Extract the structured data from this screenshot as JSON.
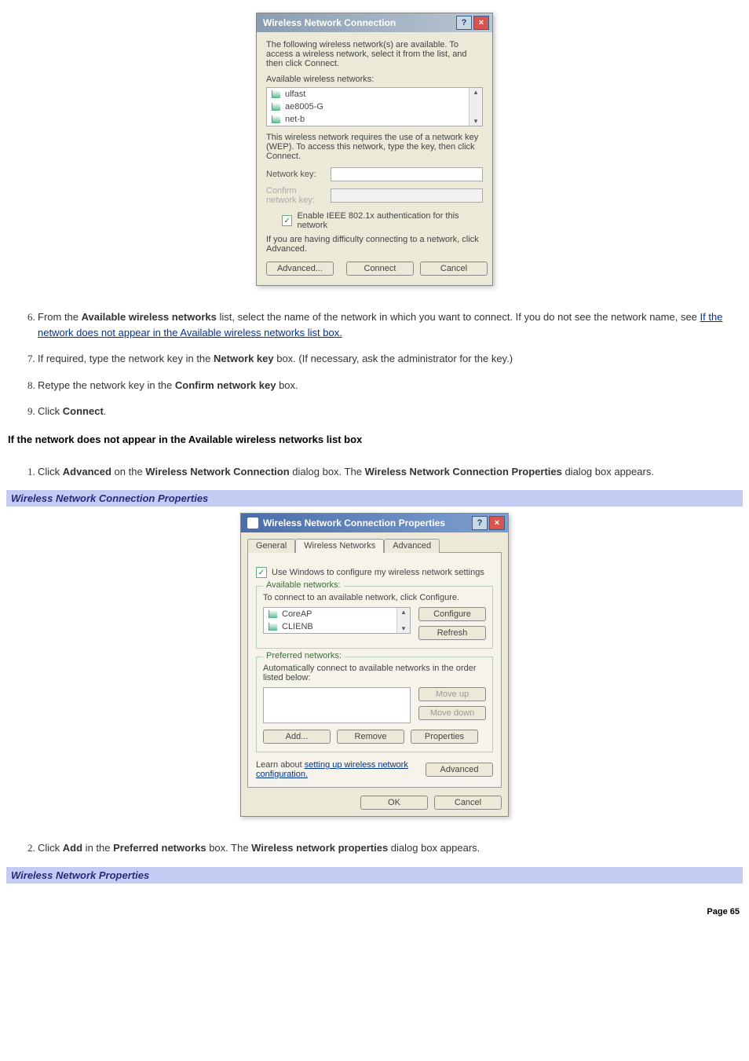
{
  "dialog1": {
    "title": "Wireless Network Connection",
    "intro": "The following wireless network(s) are available. To access a wireless network, select it from the list, and then click Connect.",
    "avail_label": "Available wireless networks:",
    "networks": [
      "ulfast",
      "ae8005-G",
      "net-b"
    ],
    "wep_text": "This wireless network requires the use of a network key (WEP). To access this network, type the key, then click Connect.",
    "netkey_label": "Network key:",
    "confirm_label": "Confirm network key:",
    "ieee_check": "Enable IEEE 802.1x authentication for this network",
    "difficulty": "If you are having difficulty connecting to a network, click Advanced.",
    "btn_advanced": "Advanced...",
    "btn_connect": "Connect",
    "btn_cancel": "Cancel"
  },
  "steps_a": {
    "s6_a": "From the ",
    "s6_b": "Available wireless networks",
    "s6_c": " list, select the name of the network in which you want to connect. If you do not see the network name, see ",
    "s6_link": "If the network does not appear in the Available wireless networks list box.",
    "s7_a": "If required, type the network key in the ",
    "s7_b": "Network key",
    "s7_c": " box. (If necessary, ask the administrator for the key.)",
    "s8_a": "Retype the network key in the ",
    "s8_b": "Confirm network key",
    "s8_c": " box.",
    "s9_a": "Click ",
    "s9_b": "Connect",
    "s9_c": "."
  },
  "heading_b": "If the network does not appear in the Available wireless networks list box",
  "steps_b": {
    "s1_a": "Click ",
    "s1_b": "Advanced",
    "s1_c": " on the ",
    "s1_d": "Wireless Network Connection",
    "s1_e": " dialog box. The ",
    "s1_f": "Wireless Network Connection Properties",
    "s1_g": " dialog box appears."
  },
  "bluehdr1": "Wireless Network Connection Properties",
  "dialog2": {
    "title": "Wireless Network Connection Properties",
    "tab_general": "General",
    "tab_wireless": "Wireless Networks",
    "tab_advanced": "Advanced",
    "use_windows": "Use Windows to configure my wireless network settings",
    "avail_legend": "Available networks:",
    "avail_text": "To connect to an available network, click Configure.",
    "avail_items": [
      "CoreAP",
      "CLIENB"
    ],
    "btn_configure": "Configure",
    "btn_refresh": "Refresh",
    "pref_legend": "Preferred networks:",
    "pref_text": "Automatically connect to available networks in the order listed below:",
    "btn_moveup": "Move up",
    "btn_movedown": "Move down",
    "btn_add": "Add...",
    "btn_remove": "Remove",
    "btn_properties": "Properties",
    "learn_a": "Learn about ",
    "learn_link": "setting up wireless network configuration.",
    "btn_advanced": "Advanced",
    "btn_ok": "OK",
    "btn_cancel": "Cancel"
  },
  "steps_c": {
    "s2_a": "Click ",
    "s2_b": "Add",
    "s2_c": " in the ",
    "s2_d": "Preferred networks",
    "s2_e": " box. The ",
    "s2_f": "Wireless network properties",
    "s2_g": " dialog box appears."
  },
  "bluehdr2": "Wireless Network Properties",
  "page_num": "Page 65"
}
